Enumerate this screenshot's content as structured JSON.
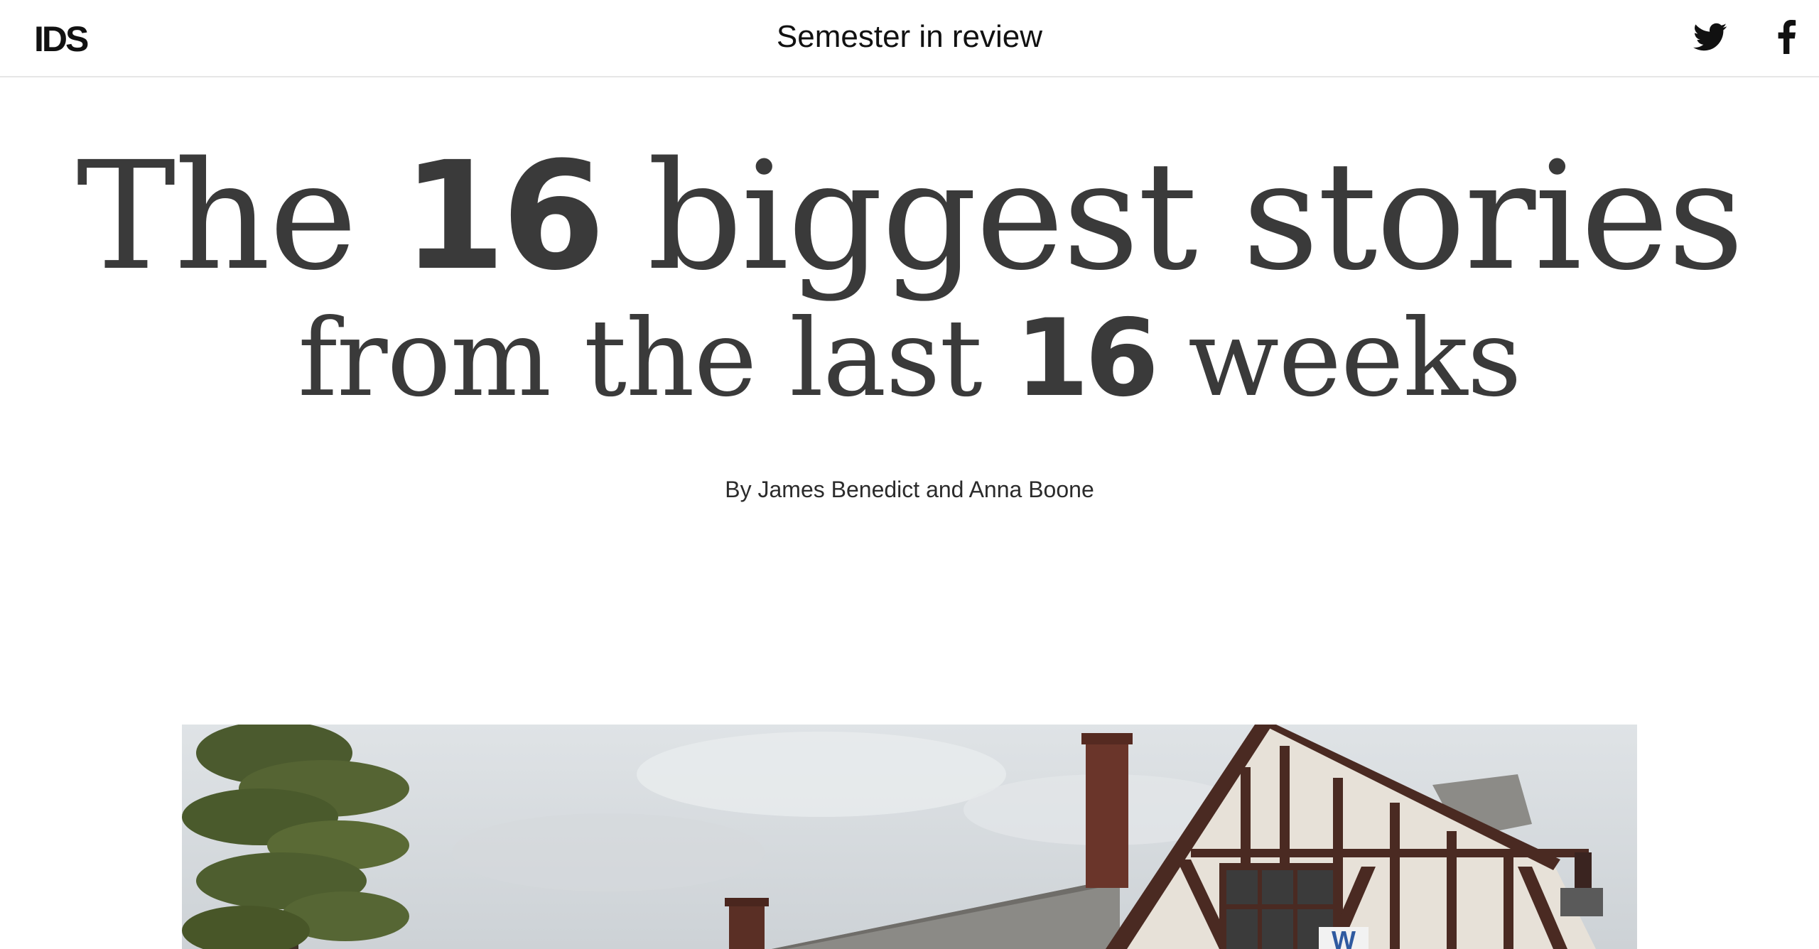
{
  "header": {
    "logo": "IDS",
    "section_title": "Semester in review",
    "social": [
      {
        "name": "twitter",
        "icon": "twitter-bird-icon"
      },
      {
        "name": "facebook",
        "icon": "facebook-f-icon"
      }
    ]
  },
  "headline": {
    "line1_pre": "The ",
    "line1_num": "16",
    "line1_post": " biggest stories",
    "line2_pre": "from the last ",
    "line2_num": "16",
    "line2_post": " weeks"
  },
  "byline": "By James Benedict and Anna Boone",
  "hero": {
    "banner_letter": "W"
  },
  "colors": {
    "text": "#333333",
    "header_border": "#e6e6e6",
    "timber": "#4a2a22",
    "stucco": "#e7e1d8",
    "sky": "#d9dde1"
  }
}
